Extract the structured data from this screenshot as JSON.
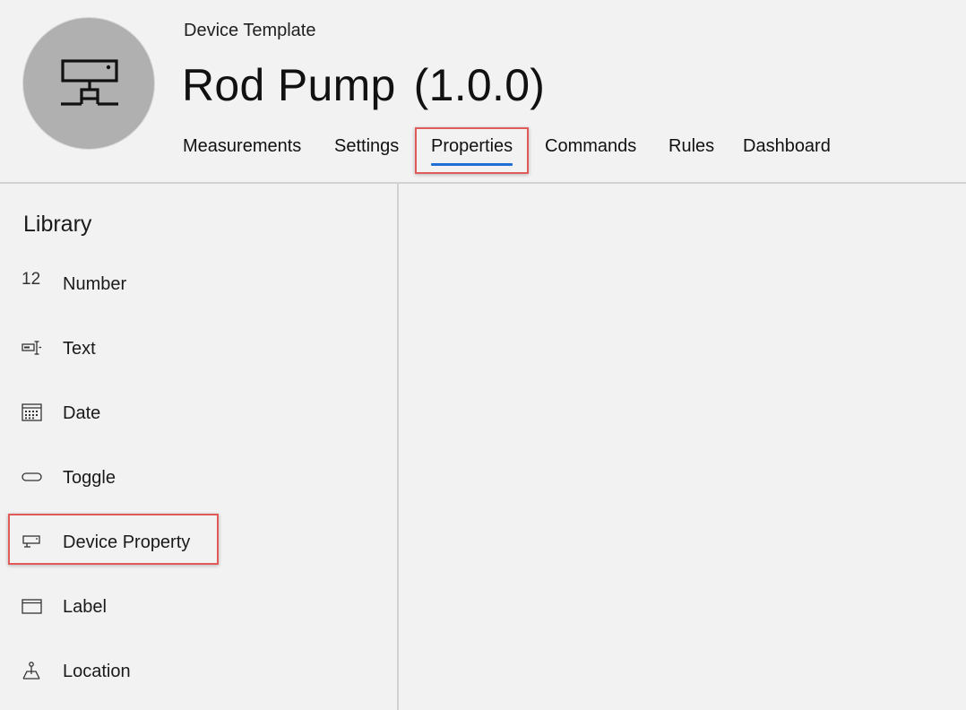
{
  "header": {
    "subtitle": "Device Template",
    "title": "Rod Pump",
    "version": "(1.0.0)",
    "avatar_icon": "device-network-icon"
  },
  "tabs": [
    {
      "label": "Measurements",
      "active": false
    },
    {
      "label": "Settings",
      "active": false
    },
    {
      "label": "Properties",
      "active": true
    },
    {
      "label": "Commands",
      "active": false
    },
    {
      "label": "Rules",
      "active": false
    },
    {
      "label": "Dashboard",
      "active": false
    }
  ],
  "library": {
    "title": "Library",
    "items": [
      {
        "label": "Number",
        "icon": "number-icon",
        "icon_text": "12"
      },
      {
        "label": "Text",
        "icon": "text-field-icon"
      },
      {
        "label": "Date",
        "icon": "calendar-icon"
      },
      {
        "label": "Toggle",
        "icon": "toggle-icon"
      },
      {
        "label": "Device Property",
        "icon": "device-property-icon",
        "highlighted": true
      },
      {
        "label": "Label",
        "icon": "label-icon"
      },
      {
        "label": "Location",
        "icon": "location-icon"
      }
    ]
  },
  "colors": {
    "background": "#f2f2f2",
    "avatar": "#b0b0b0",
    "accent": "#1f6fd6",
    "highlight": "#e05a5a",
    "divider": "#d2d2d2"
  }
}
